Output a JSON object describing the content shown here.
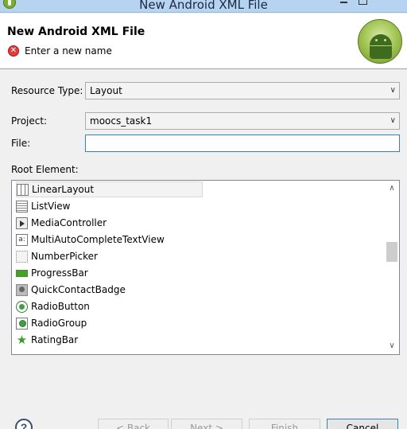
{
  "window": {
    "title": "New Android XML File",
    "icons": {
      "app": "android-eclipse-icon",
      "minimize": "minimize-icon",
      "maximize": "maximize-icon"
    }
  },
  "header": {
    "heading": "New Android XML File",
    "error_message": "Enter a new name",
    "error_icon": "error-icon",
    "logo": "android-robot-logo"
  },
  "form": {
    "resource_type_label": "Resource Type:",
    "resource_type_value": "Layout",
    "project_label": "Project:",
    "project_value": "moocs_task1",
    "file_label": "File:",
    "file_value": "",
    "root_element_label": "Root Element:"
  },
  "root_elements": [
    {
      "label": "LinearLayout",
      "icon": "linear-layout-icon",
      "selected": true
    },
    {
      "label": "ListView",
      "icon": "list-view-icon"
    },
    {
      "label": "MediaController",
      "icon": "media-controller-icon"
    },
    {
      "label": "MultiAutoCompleteTextView",
      "icon": "multi-autocomplete-icon",
      "icon_text": "a:"
    },
    {
      "label": "NumberPicker",
      "icon": "number-picker-icon"
    },
    {
      "label": "ProgressBar",
      "icon": "progress-bar-icon"
    },
    {
      "label": "QuickContactBadge",
      "icon": "quick-contact-badge-icon"
    },
    {
      "label": "RadioButton",
      "icon": "radio-button-icon"
    },
    {
      "label": "RadioGroup",
      "icon": "radio-group-icon"
    },
    {
      "label": "RatingBar",
      "icon": "rating-bar-icon",
      "icon_text": "★"
    }
  ],
  "buttons": {
    "help": "?",
    "back": "< Back",
    "next": "Next >",
    "finish": "Finish",
    "cancel": "Cancel"
  },
  "colors": {
    "error": "#e53d3d",
    "focus_border": "#3c7fb1",
    "android_green": "#a4c639"
  }
}
